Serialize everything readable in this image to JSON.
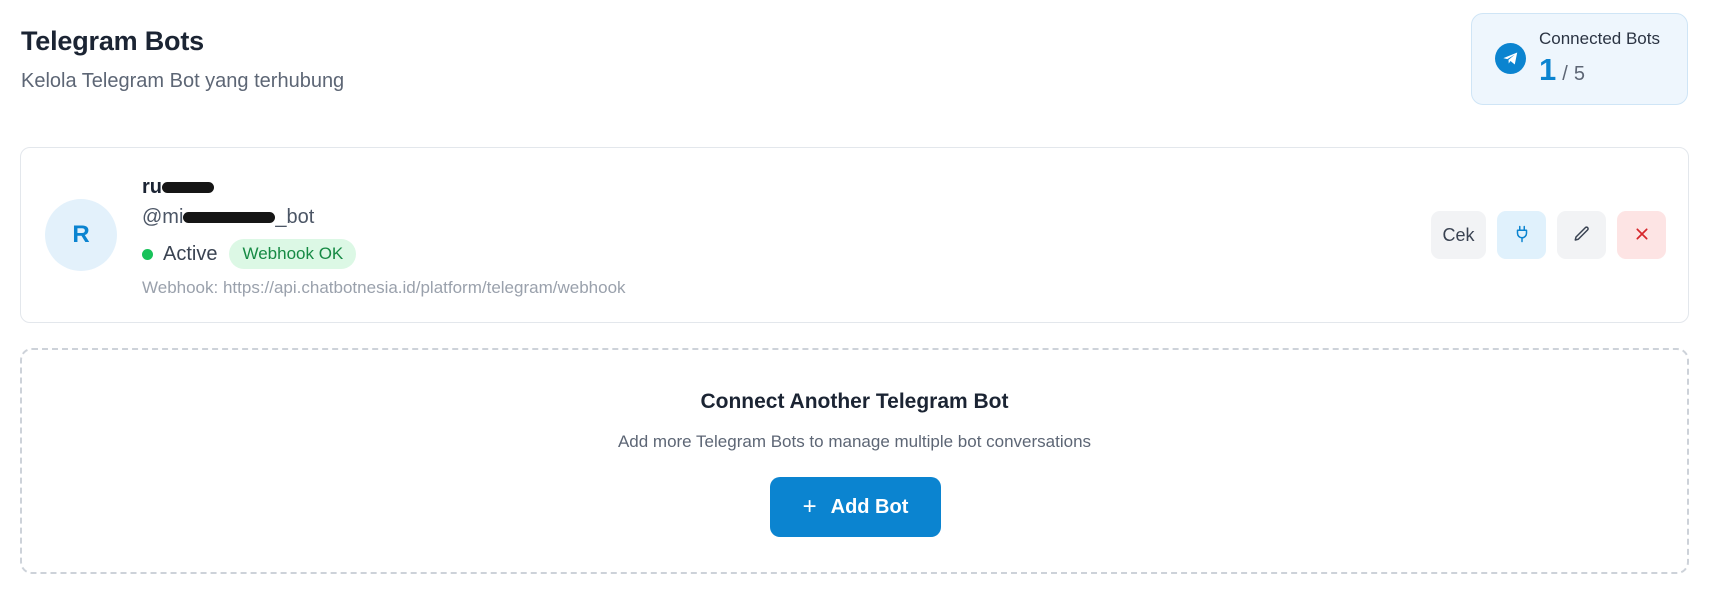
{
  "header": {
    "title": "Telegram Bots",
    "subtitle": "Kelola Telegram Bot yang terhubung"
  },
  "stats": {
    "label": "Connected Bots",
    "count": "1",
    "separator": "/",
    "max": "5",
    "icon": "telegram-icon"
  },
  "bot": {
    "avatar_letter": "R",
    "name_visible": "ru",
    "username_prefix": "@mi",
    "username_suffix": "_bot",
    "status": "Active",
    "webhook_badge": "Webhook OK",
    "webhook_url": "Webhook: https://api.chatbotnesia.id/platform/telegram/webhook",
    "actions": {
      "check_label": "Cek",
      "webhook_icon": "plug-icon",
      "edit_icon": "pencil-icon",
      "delete_icon": "close-icon"
    }
  },
  "add_section": {
    "title": "Connect Another Telegram Bot",
    "description": "Add more Telegram Bots to manage multiple bot conversations",
    "button_label": "Add Bot"
  },
  "colors": {
    "accent": "#0b84d0",
    "status_active": "#18c25a",
    "badge_bg": "#dcf8e5",
    "delete": "#d6262b"
  }
}
